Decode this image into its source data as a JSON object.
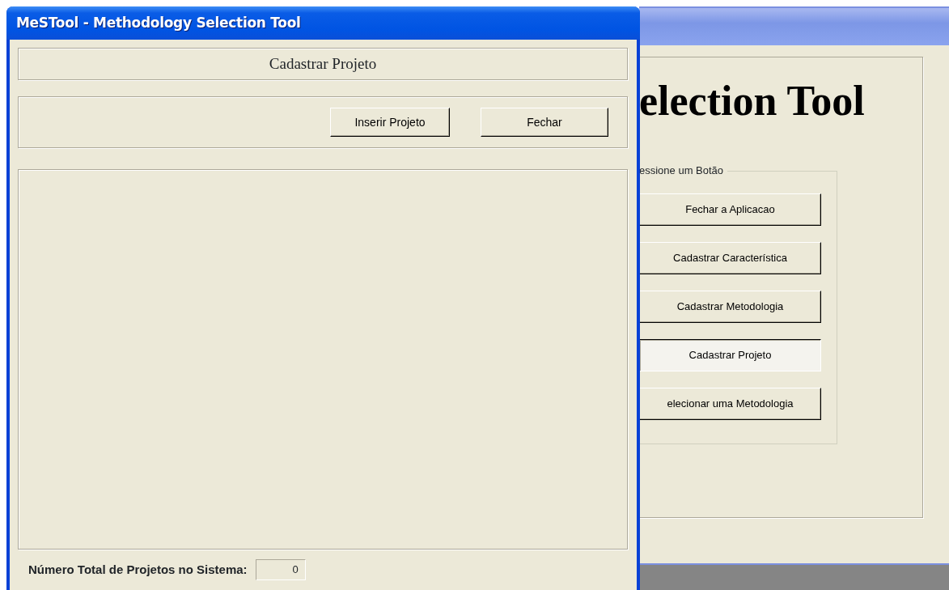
{
  "back_window": {
    "heading": "election Tool",
    "group": {
      "legend": "essione um Botão",
      "buttons": [
        {
          "label": "Fechar a Aplicacao",
          "selected": false
        },
        {
          "label": "Cadastrar Característica",
          "selected": false
        },
        {
          "label": "Cadastrar Metodologia",
          "selected": false
        },
        {
          "label": "Cadastrar Projeto",
          "selected": true
        },
        {
          "label": "elecionar uma Metodologia",
          "selected": false
        }
      ]
    }
  },
  "window": {
    "title": "MeSTool - Methodology Selection Tool",
    "active": true,
    "header": "Cadastrar Projeto",
    "buttons": [
      "Inserir Projeto",
      "Fechar"
    ],
    "footer": {
      "label": "Número Total de Projetos no Sistema:",
      "value": "0"
    }
  }
}
